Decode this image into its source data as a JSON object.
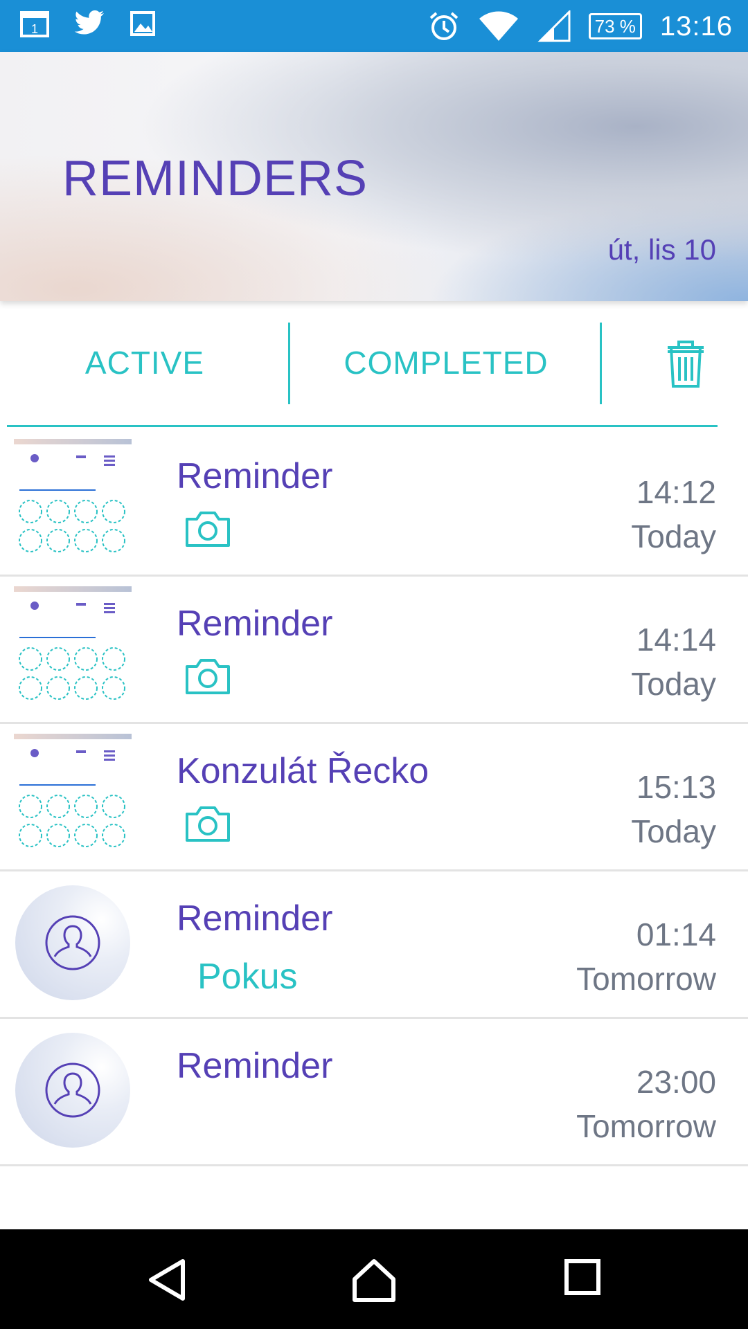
{
  "status_bar": {
    "icons_left": [
      "calendar-icon",
      "twitter-icon",
      "gallery-icon"
    ],
    "icons_right": [
      "alarm-icon",
      "wifi-icon",
      "signal-icon"
    ],
    "battery": "73 %",
    "time": "13:16"
  },
  "header": {
    "title": "REMINDERS",
    "date": "út, lis 10"
  },
  "tabs": {
    "active": "ACTIVE",
    "completed": "COMPLETED",
    "delete_icon": "trash-icon"
  },
  "colors": {
    "accent": "#29c2c4",
    "primary": "#5540b5",
    "status_bar": "#1a8fd6",
    "secondary_text": "#6e7685"
  },
  "reminders": [
    {
      "title": "Reminder",
      "time": "14:12",
      "day": "Today",
      "thumb": "screenshot",
      "attachment": "camera-icon",
      "note": ""
    },
    {
      "title": "Reminder",
      "time": "14:14",
      "day": "Today",
      "thumb": "screenshot",
      "attachment": "camera-icon",
      "note": ""
    },
    {
      "title": "Konzulát Řecko",
      "time": "15:13",
      "day": "Today",
      "thumb": "screenshot",
      "attachment": "camera-icon",
      "note": ""
    },
    {
      "title": "Reminder",
      "time": "01:14",
      "day": "Tomorrow",
      "thumb": "avatar",
      "attachment": "",
      "note": "Pokus"
    },
    {
      "title": "Reminder",
      "time": "23:00",
      "day": "Tomorrow",
      "thumb": "avatar",
      "attachment": "",
      "note": ""
    }
  ],
  "nav_bar": {
    "buttons": [
      "back-icon",
      "home-icon",
      "recents-icon"
    ]
  }
}
